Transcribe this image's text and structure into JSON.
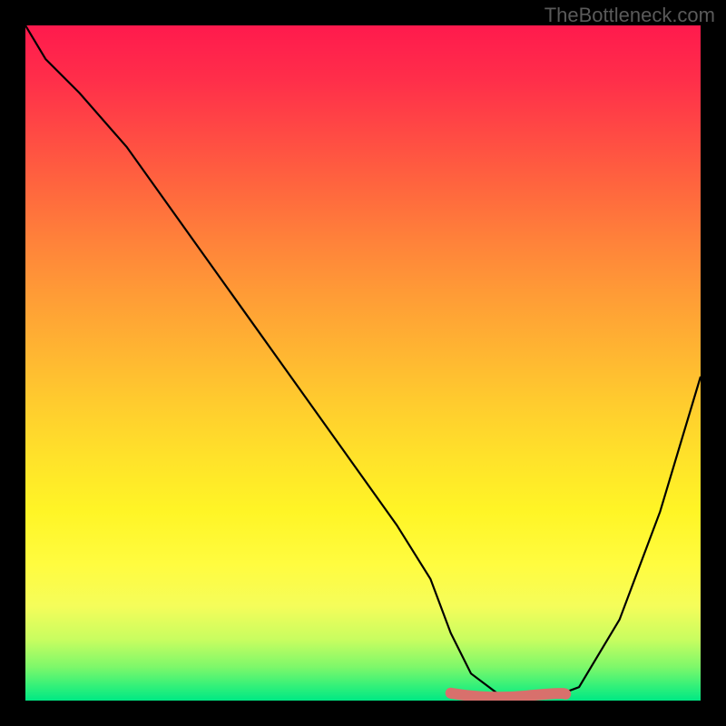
{
  "watermark": "TheBottleneck.com",
  "chart_data": {
    "type": "line",
    "title": "",
    "xlabel": "",
    "ylabel": "",
    "xlim": [
      0,
      100
    ],
    "ylim": [
      0,
      100
    ],
    "series": [
      {
        "name": "bottleneck-curve",
        "x": [
          0,
          3,
          8,
          15,
          25,
          35,
          45,
          55,
          60,
          63,
          66,
          70,
          74,
          78,
          82,
          88,
          94,
          100
        ],
        "y": [
          100,
          95,
          90,
          82,
          68,
          54,
          40,
          26,
          18,
          10,
          4,
          1,
          0.5,
          0.5,
          2,
          12,
          28,
          48
        ]
      }
    ],
    "accent_region": {
      "name": "optimal-zone",
      "x_start": 63,
      "x_end": 80,
      "y": 0.7
    },
    "background_gradient": {
      "orientation": "vertical",
      "stops": [
        {
          "pos": 0.0,
          "color": "#ff1a4d"
        },
        {
          "pos": 0.5,
          "color": "#ffb432"
        },
        {
          "pos": 0.8,
          "color": "#fffc40"
        },
        {
          "pos": 1.0,
          "color": "#00e884"
        }
      ]
    }
  }
}
